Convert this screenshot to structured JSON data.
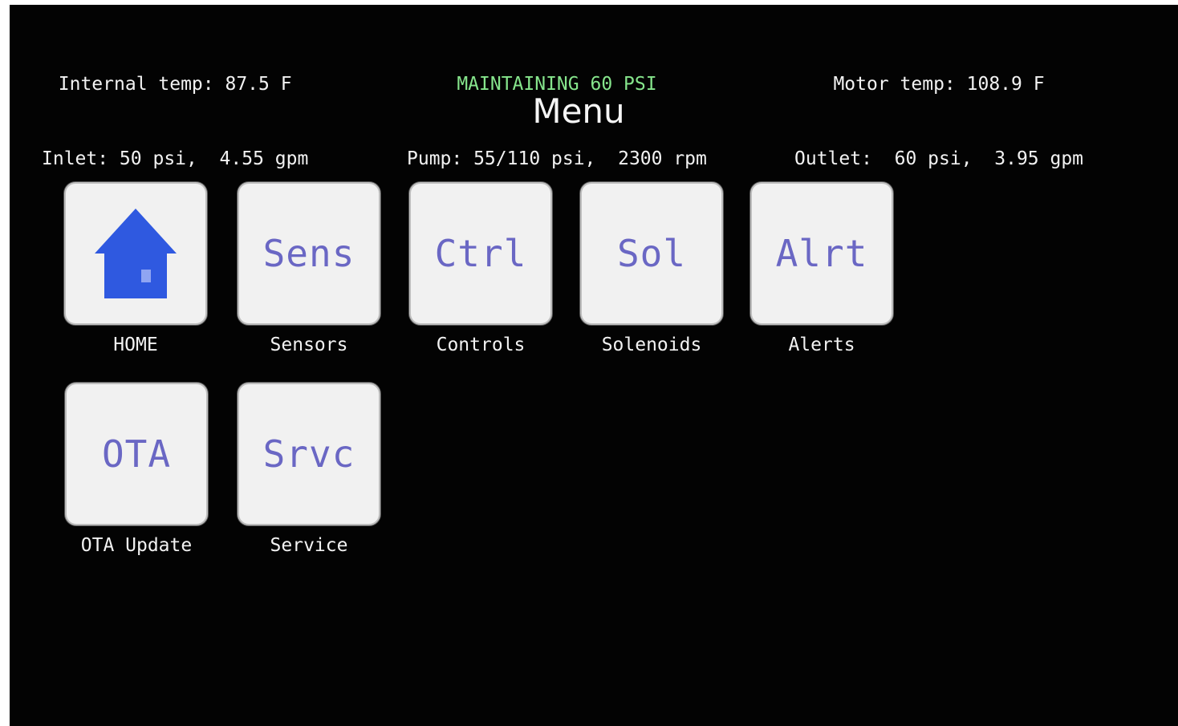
{
  "status": {
    "internal_temp": "Internal temp: 87.5 F",
    "inlet": "Inlet: 50 psi,  4.55 gpm",
    "mode": "MAINTAINING 60 PSI",
    "pump": "Pump: 55/110 psi,  2300 rpm",
    "motor_temp": "Motor temp: 108.9 F",
    "outlet": "Outlet:  60 psi,  3.95 gpm"
  },
  "title": "Menu",
  "colors": {
    "accent_green": "#86e58c",
    "tile_text_purple": "#6a67c4",
    "home_icon_blue": "#2f59e0"
  },
  "tiles": [
    {
      "icon": "house-icon",
      "tile_text": "",
      "label": "HOME"
    },
    {
      "icon": "",
      "tile_text": "Sens",
      "label": "Sensors"
    },
    {
      "icon": "",
      "tile_text": "Ctrl",
      "label": "Controls"
    },
    {
      "icon": "",
      "tile_text": "Sol",
      "label": "Solenoids"
    },
    {
      "icon": "",
      "tile_text": "Alrt",
      "label": "Alerts"
    },
    {
      "icon": "",
      "tile_text": "OTA",
      "label": "OTA Update"
    },
    {
      "icon": "",
      "tile_text": "Srvc",
      "label": "Service"
    }
  ]
}
